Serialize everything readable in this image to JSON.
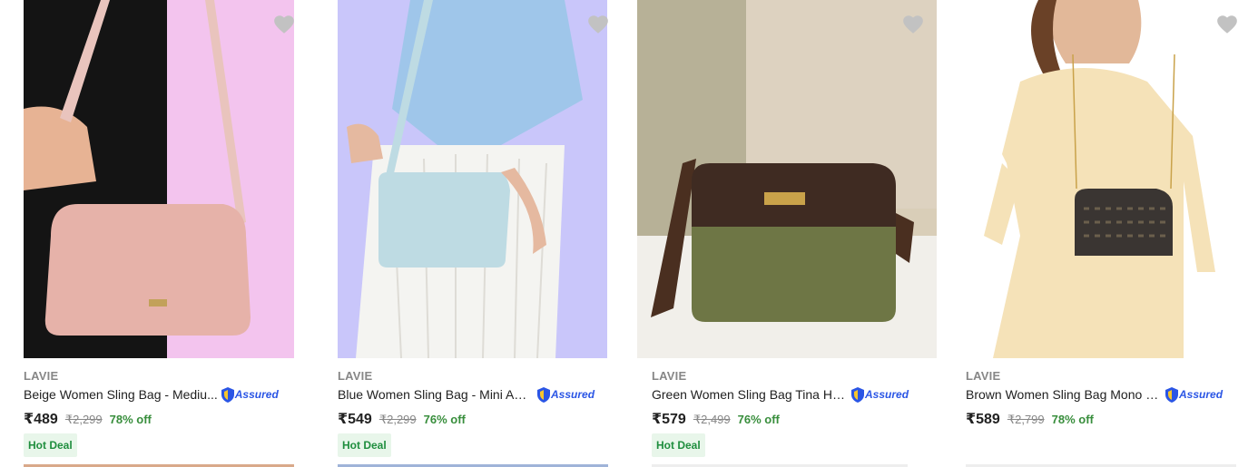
{
  "products": [
    {
      "brand": "LAVIE",
      "title": "Beige Women Sling Bag - Mediu...",
      "assured_label": "Assured",
      "price": "₹489",
      "mrp": "₹2,299",
      "discount": "78% off",
      "badge": "Hot Deal",
      "image_bg": "#f5c6f0",
      "bag_color": "#e6b3aa"
    },
    {
      "brand": "LAVIE",
      "title": "Blue Women Sling Bag - Mini AR...",
      "assured_label": "Assured",
      "price": "₹549",
      "mrp": "₹2,299",
      "discount": "76% off",
      "badge": "Hot Deal",
      "image_bg": "#c9c7fb",
      "bag_color": "#bfdbe2"
    },
    {
      "brand": "LAVIE",
      "title": "Green Women Sling Bag Tina HZ...",
      "assured_label": "Assured",
      "price": "₹579",
      "mrp": "₹2,499",
      "discount": "76% off",
      "badge": "Hot Deal",
      "image_bg": "#cdbfa9",
      "bag_color": "#6e7645"
    },
    {
      "brand": "LAVIE",
      "title": "Brown Women Sling Bag Mono L...",
      "assured_label": "Assured",
      "price": "₹589",
      "mrp": "₹2,799",
      "discount": "78% off",
      "badge": "",
      "image_bg": "#f2ece1",
      "bag_color": "#3a3532"
    }
  ],
  "colors": {
    "accent_green": "#388e3c",
    "assured_blue": "#2a55e5",
    "wishlist_grey": "#c2c2c2"
  }
}
